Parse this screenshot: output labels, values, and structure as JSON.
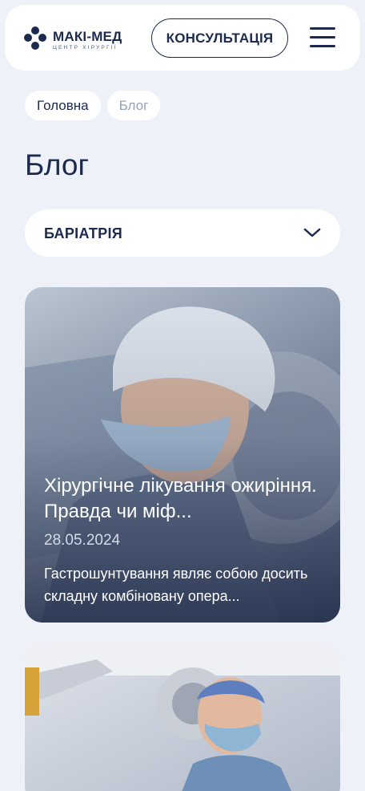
{
  "header": {
    "logo_text": "МАКІ-МЕД",
    "logo_subtitle": "ЦЕНТР ХІРУРГІЇ",
    "consult_label": "КОНСУЛЬТАЦІЯ",
    "menu_icon": "hamburger-icon"
  },
  "breadcrumbs": [
    {
      "label": "Головна"
    },
    {
      "label": "Блог"
    }
  ],
  "page": {
    "title": "Блог"
  },
  "filter": {
    "selected": "БАРІАТРІЯ",
    "icon": "chevron-down-icon"
  },
  "posts": [
    {
      "title": "Хірургічне лікування ожиріння. Правда чи міф...",
      "date": "28.05.2024",
      "excerpt": "Гастрошунтування являє собою досить складну комбіновану опера..."
    },
    {
      "title": "",
      "date": "",
      "excerpt": ""
    }
  ],
  "colors": {
    "background": "#eef1f7",
    "primary": "#1c2a4d",
    "muted": "#9aa3b8",
    "surface": "#ffffff"
  }
}
